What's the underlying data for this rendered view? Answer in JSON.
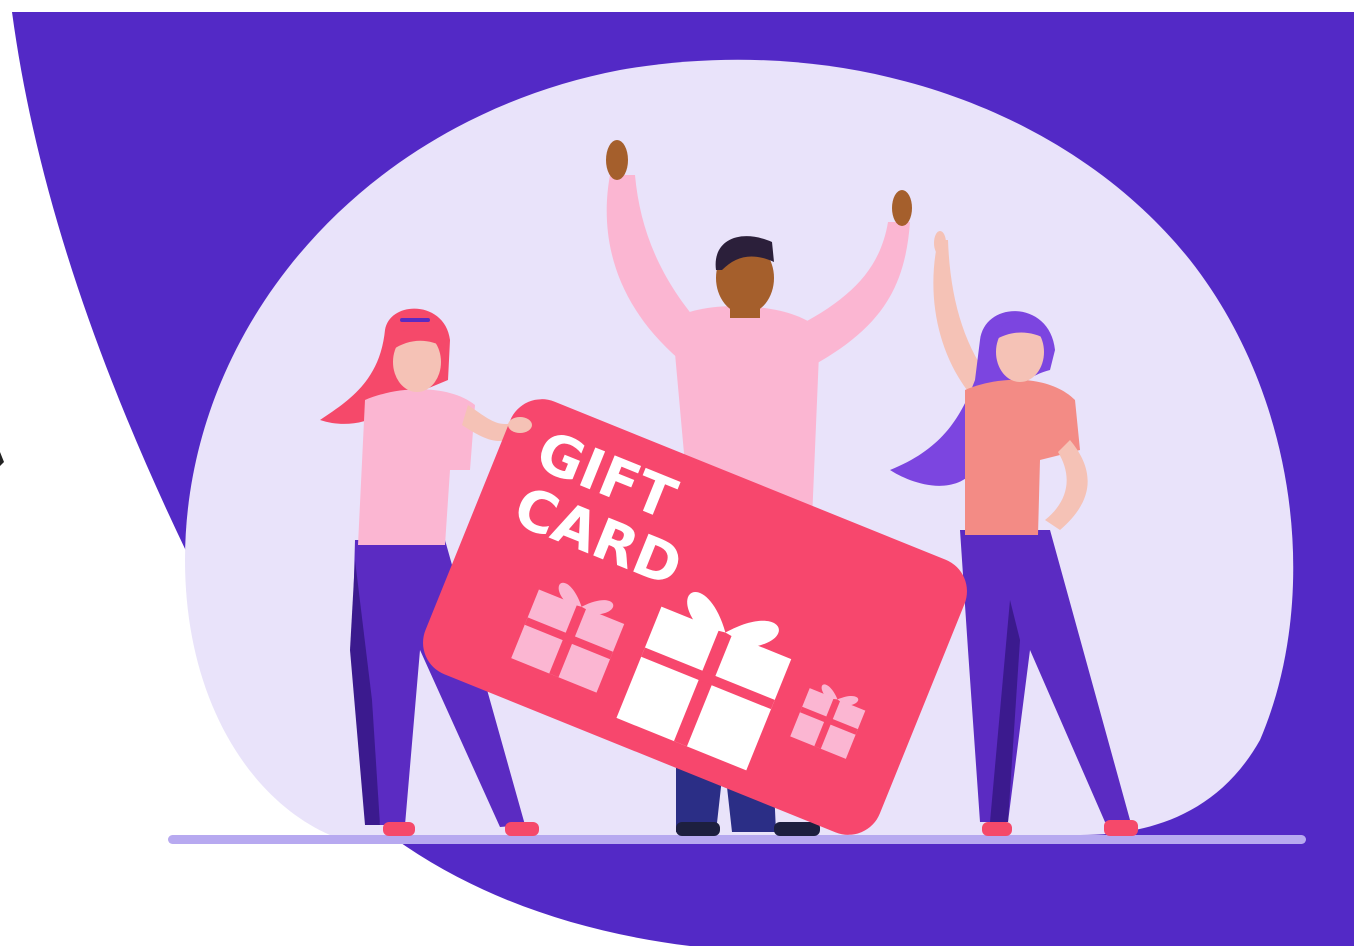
{
  "gift_card": {
    "line1": "GIFT",
    "line2": "CARD"
  },
  "colors": {
    "background": "#ffffff",
    "purple_blob": "#5329C6",
    "lavender_bubble": "#E9E3FA",
    "card_red": "#F7476D",
    "floor_line": "#B7A9F0",
    "pink_shirt": "#FBB6D2",
    "coral_shirt": "#F38B85",
    "pants_purple": "#5B2BC2",
    "pants_dark": "#3B1A8E",
    "jeans": "#2B2E86",
    "red_hair": "#F5496A",
    "violet_hair": "#7C45E0",
    "skin_light": "#F5C2B6",
    "skin_dark": "#A55F2C",
    "hair_dark": "#2B1F3A"
  },
  "icons": [
    "gift-icon",
    "gift-icon",
    "gift-icon"
  ]
}
